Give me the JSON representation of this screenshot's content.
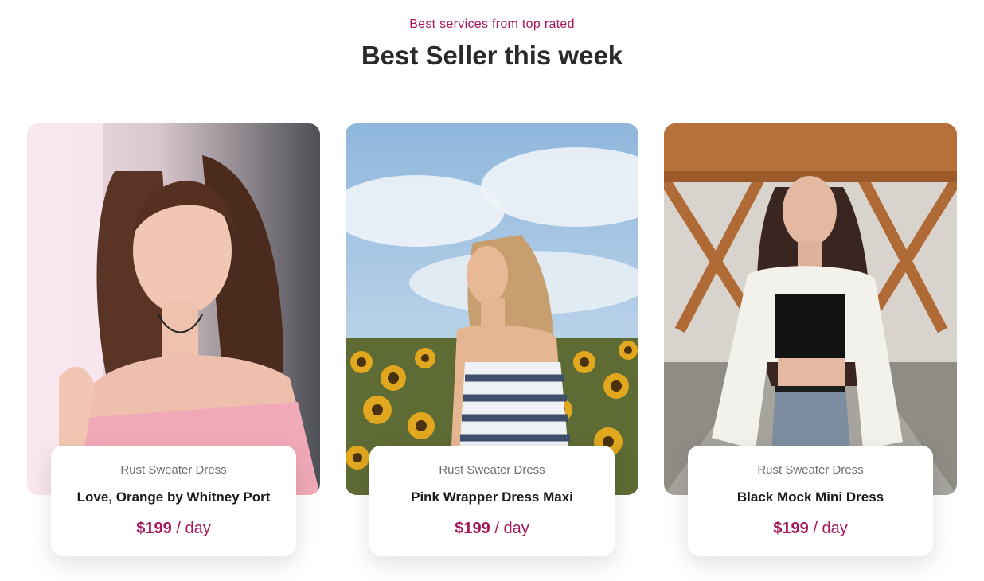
{
  "section": {
    "eyebrow": "Best services from top rated",
    "title": "Best Seller this week"
  },
  "products": [
    {
      "category": "Rust Sweater Dress",
      "name": "Love, Orange by Whitney Port",
      "price": "$199",
      "period": "/ day",
      "image": "woman-pink-sweater-photo"
    },
    {
      "category": "Rust Sweater Dress",
      "name": "Pink Wrapper Dress Maxi",
      "price": "$199",
      "period": "/ day",
      "image": "woman-sunflower-field-photo"
    },
    {
      "category": "Rust Sweater Dress",
      "name": "Black Mock Mini Dress",
      "price": "$199",
      "period": "/ day",
      "image": "woman-bridge-denim-photo"
    }
  ],
  "colors": {
    "accent": "#a5175c",
    "heading": "#2a2a2a",
    "muted": "#6f6f6f"
  }
}
